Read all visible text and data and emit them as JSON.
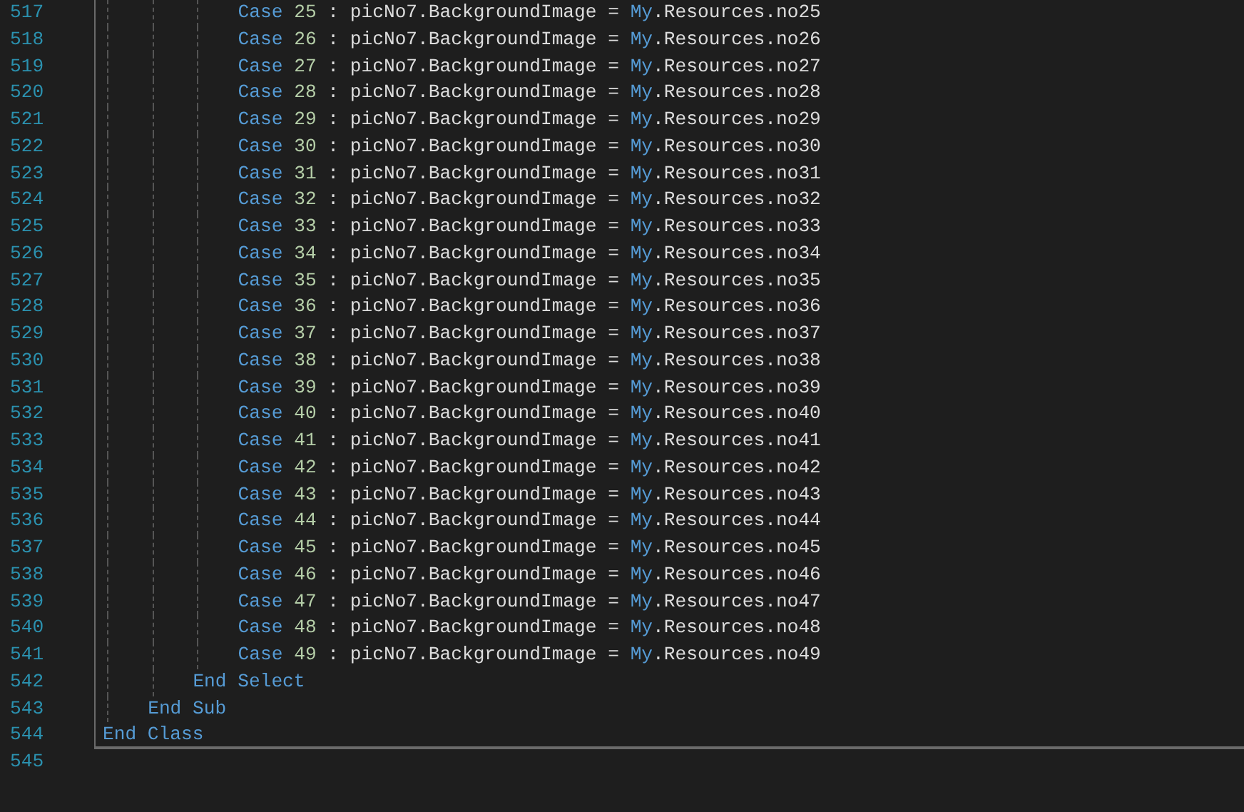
{
  "editor": {
    "lines": [
      {
        "number": "517",
        "tokens": [
          {
            "kind": "keyword",
            "text": "            Case"
          },
          {
            "kind": "number",
            "text": " 25"
          },
          {
            "kind": "plain",
            "text": " : picNo7.BackgroundImage = "
          },
          {
            "kind": "keyword",
            "text": "My"
          },
          {
            "kind": "plain",
            "text": ".Resources.no25"
          }
        ]
      },
      {
        "number": "518",
        "tokens": [
          {
            "kind": "keyword",
            "text": "            Case"
          },
          {
            "kind": "number",
            "text": " 26"
          },
          {
            "kind": "plain",
            "text": " : picNo7.BackgroundImage = "
          },
          {
            "kind": "keyword",
            "text": "My"
          },
          {
            "kind": "plain",
            "text": ".Resources.no26"
          }
        ]
      },
      {
        "number": "519",
        "tokens": [
          {
            "kind": "keyword",
            "text": "            Case"
          },
          {
            "kind": "number",
            "text": " 27"
          },
          {
            "kind": "plain",
            "text": " : picNo7.BackgroundImage = "
          },
          {
            "kind": "keyword",
            "text": "My"
          },
          {
            "kind": "plain",
            "text": ".Resources.no27"
          }
        ]
      },
      {
        "number": "520",
        "tokens": [
          {
            "kind": "keyword",
            "text": "            Case"
          },
          {
            "kind": "number",
            "text": " 28"
          },
          {
            "kind": "plain",
            "text": " : picNo7.BackgroundImage = "
          },
          {
            "kind": "keyword",
            "text": "My"
          },
          {
            "kind": "plain",
            "text": ".Resources.no28"
          }
        ]
      },
      {
        "number": "521",
        "tokens": [
          {
            "kind": "keyword",
            "text": "            Case"
          },
          {
            "kind": "number",
            "text": " 29"
          },
          {
            "kind": "plain",
            "text": " : picNo7.BackgroundImage = "
          },
          {
            "kind": "keyword",
            "text": "My"
          },
          {
            "kind": "plain",
            "text": ".Resources.no29"
          }
        ]
      },
      {
        "number": "522",
        "tokens": [
          {
            "kind": "keyword",
            "text": "            Case"
          },
          {
            "kind": "number",
            "text": " 30"
          },
          {
            "kind": "plain",
            "text": " : picNo7.BackgroundImage = "
          },
          {
            "kind": "keyword",
            "text": "My"
          },
          {
            "kind": "plain",
            "text": ".Resources.no30"
          }
        ]
      },
      {
        "number": "523",
        "tokens": [
          {
            "kind": "keyword",
            "text": "            Case"
          },
          {
            "kind": "number",
            "text": " 31"
          },
          {
            "kind": "plain",
            "text": " : picNo7.BackgroundImage = "
          },
          {
            "kind": "keyword",
            "text": "My"
          },
          {
            "kind": "plain",
            "text": ".Resources.no31"
          }
        ]
      },
      {
        "number": "524",
        "tokens": [
          {
            "kind": "keyword",
            "text": "            Case"
          },
          {
            "kind": "number",
            "text": " 32"
          },
          {
            "kind": "plain",
            "text": " : picNo7.BackgroundImage = "
          },
          {
            "kind": "keyword",
            "text": "My"
          },
          {
            "kind": "plain",
            "text": ".Resources.no32"
          }
        ]
      },
      {
        "number": "525",
        "tokens": [
          {
            "kind": "keyword",
            "text": "            Case"
          },
          {
            "kind": "number",
            "text": " 33"
          },
          {
            "kind": "plain",
            "text": " : picNo7.BackgroundImage = "
          },
          {
            "kind": "keyword",
            "text": "My"
          },
          {
            "kind": "plain",
            "text": ".Resources.no33"
          }
        ]
      },
      {
        "number": "526",
        "tokens": [
          {
            "kind": "keyword",
            "text": "            Case"
          },
          {
            "kind": "number",
            "text": " 34"
          },
          {
            "kind": "plain",
            "text": " : picNo7.BackgroundImage = "
          },
          {
            "kind": "keyword",
            "text": "My"
          },
          {
            "kind": "plain",
            "text": ".Resources.no34"
          }
        ]
      },
      {
        "number": "527",
        "tokens": [
          {
            "kind": "keyword",
            "text": "            Case"
          },
          {
            "kind": "number",
            "text": " 35"
          },
          {
            "kind": "plain",
            "text": " : picNo7.BackgroundImage = "
          },
          {
            "kind": "keyword",
            "text": "My"
          },
          {
            "kind": "plain",
            "text": ".Resources.no35"
          }
        ]
      },
      {
        "number": "528",
        "tokens": [
          {
            "kind": "keyword",
            "text": "            Case"
          },
          {
            "kind": "number",
            "text": " 36"
          },
          {
            "kind": "plain",
            "text": " : picNo7.BackgroundImage = "
          },
          {
            "kind": "keyword",
            "text": "My"
          },
          {
            "kind": "plain",
            "text": ".Resources.no36"
          }
        ]
      },
      {
        "number": "529",
        "tokens": [
          {
            "kind": "keyword",
            "text": "            Case"
          },
          {
            "kind": "number",
            "text": " 37"
          },
          {
            "kind": "plain",
            "text": " : picNo7.BackgroundImage = "
          },
          {
            "kind": "keyword",
            "text": "My"
          },
          {
            "kind": "plain",
            "text": ".Resources.no37"
          }
        ]
      },
      {
        "number": "530",
        "tokens": [
          {
            "kind": "keyword",
            "text": "            Case"
          },
          {
            "kind": "number",
            "text": " 38"
          },
          {
            "kind": "plain",
            "text": " : picNo7.BackgroundImage = "
          },
          {
            "kind": "keyword",
            "text": "My"
          },
          {
            "kind": "plain",
            "text": ".Resources.no38"
          }
        ]
      },
      {
        "number": "531",
        "tokens": [
          {
            "kind": "keyword",
            "text": "            Case"
          },
          {
            "kind": "number",
            "text": " 39"
          },
          {
            "kind": "plain",
            "text": " : picNo7.BackgroundImage = "
          },
          {
            "kind": "keyword",
            "text": "My"
          },
          {
            "kind": "plain",
            "text": ".Resources.no39"
          }
        ]
      },
      {
        "number": "532",
        "tokens": [
          {
            "kind": "keyword",
            "text": "            Case"
          },
          {
            "kind": "number",
            "text": " 40"
          },
          {
            "kind": "plain",
            "text": " : picNo7.BackgroundImage = "
          },
          {
            "kind": "keyword",
            "text": "My"
          },
          {
            "kind": "plain",
            "text": ".Resources.no40"
          }
        ]
      },
      {
        "number": "533",
        "tokens": [
          {
            "kind": "keyword",
            "text": "            Case"
          },
          {
            "kind": "number",
            "text": " 41"
          },
          {
            "kind": "plain",
            "text": " : picNo7.BackgroundImage = "
          },
          {
            "kind": "keyword",
            "text": "My"
          },
          {
            "kind": "plain",
            "text": ".Resources.no41"
          }
        ]
      },
      {
        "number": "534",
        "tokens": [
          {
            "kind": "keyword",
            "text": "            Case"
          },
          {
            "kind": "number",
            "text": " 42"
          },
          {
            "kind": "plain",
            "text": " : picNo7.BackgroundImage = "
          },
          {
            "kind": "keyword",
            "text": "My"
          },
          {
            "kind": "plain",
            "text": ".Resources.no42"
          }
        ]
      },
      {
        "number": "535",
        "tokens": [
          {
            "kind": "keyword",
            "text": "            Case"
          },
          {
            "kind": "number",
            "text": " 43"
          },
          {
            "kind": "plain",
            "text": " : picNo7.BackgroundImage = "
          },
          {
            "kind": "keyword",
            "text": "My"
          },
          {
            "kind": "plain",
            "text": ".Resources.no43"
          }
        ]
      },
      {
        "number": "536",
        "tokens": [
          {
            "kind": "keyword",
            "text": "            Case"
          },
          {
            "kind": "number",
            "text": " 44"
          },
          {
            "kind": "plain",
            "text": " : picNo7.BackgroundImage = "
          },
          {
            "kind": "keyword",
            "text": "My"
          },
          {
            "kind": "plain",
            "text": ".Resources.no44"
          }
        ]
      },
      {
        "number": "537",
        "tokens": [
          {
            "kind": "keyword",
            "text": "            Case"
          },
          {
            "kind": "number",
            "text": " 45"
          },
          {
            "kind": "plain",
            "text": " : picNo7.BackgroundImage = "
          },
          {
            "kind": "keyword",
            "text": "My"
          },
          {
            "kind": "plain",
            "text": ".Resources.no45"
          }
        ]
      },
      {
        "number": "538",
        "tokens": [
          {
            "kind": "keyword",
            "text": "            Case"
          },
          {
            "kind": "number",
            "text": " 46"
          },
          {
            "kind": "plain",
            "text": " : picNo7.BackgroundImage = "
          },
          {
            "kind": "keyword",
            "text": "My"
          },
          {
            "kind": "plain",
            "text": ".Resources.no46"
          }
        ]
      },
      {
        "number": "539",
        "tokens": [
          {
            "kind": "keyword",
            "text": "            Case"
          },
          {
            "kind": "number",
            "text": " 47"
          },
          {
            "kind": "plain",
            "text": " : picNo7.BackgroundImage = "
          },
          {
            "kind": "keyword",
            "text": "My"
          },
          {
            "kind": "plain",
            "text": ".Resources.no47"
          }
        ]
      },
      {
        "number": "540",
        "tokens": [
          {
            "kind": "keyword",
            "text": "            Case"
          },
          {
            "kind": "number",
            "text": " 48"
          },
          {
            "kind": "plain",
            "text": " : picNo7.BackgroundImage = "
          },
          {
            "kind": "keyword",
            "text": "My"
          },
          {
            "kind": "plain",
            "text": ".Resources.no48"
          }
        ]
      },
      {
        "number": "541",
        "tokens": [
          {
            "kind": "keyword",
            "text": "            Case"
          },
          {
            "kind": "number",
            "text": " 49"
          },
          {
            "kind": "plain",
            "text": " : picNo7.BackgroundImage = "
          },
          {
            "kind": "keyword",
            "text": "My"
          },
          {
            "kind": "plain",
            "text": ".Resources.no49"
          }
        ]
      },
      {
        "number": "542",
        "tokens": [
          {
            "kind": "keyword",
            "text": "        End Select"
          }
        ]
      },
      {
        "number": "543",
        "tokens": [
          {
            "kind": "keyword",
            "text": "    End Sub"
          }
        ]
      },
      {
        "number": "544",
        "tokens": [
          {
            "kind": "keyword",
            "text": "End Class"
          }
        ]
      },
      {
        "number": "545"
      }
    ]
  }
}
